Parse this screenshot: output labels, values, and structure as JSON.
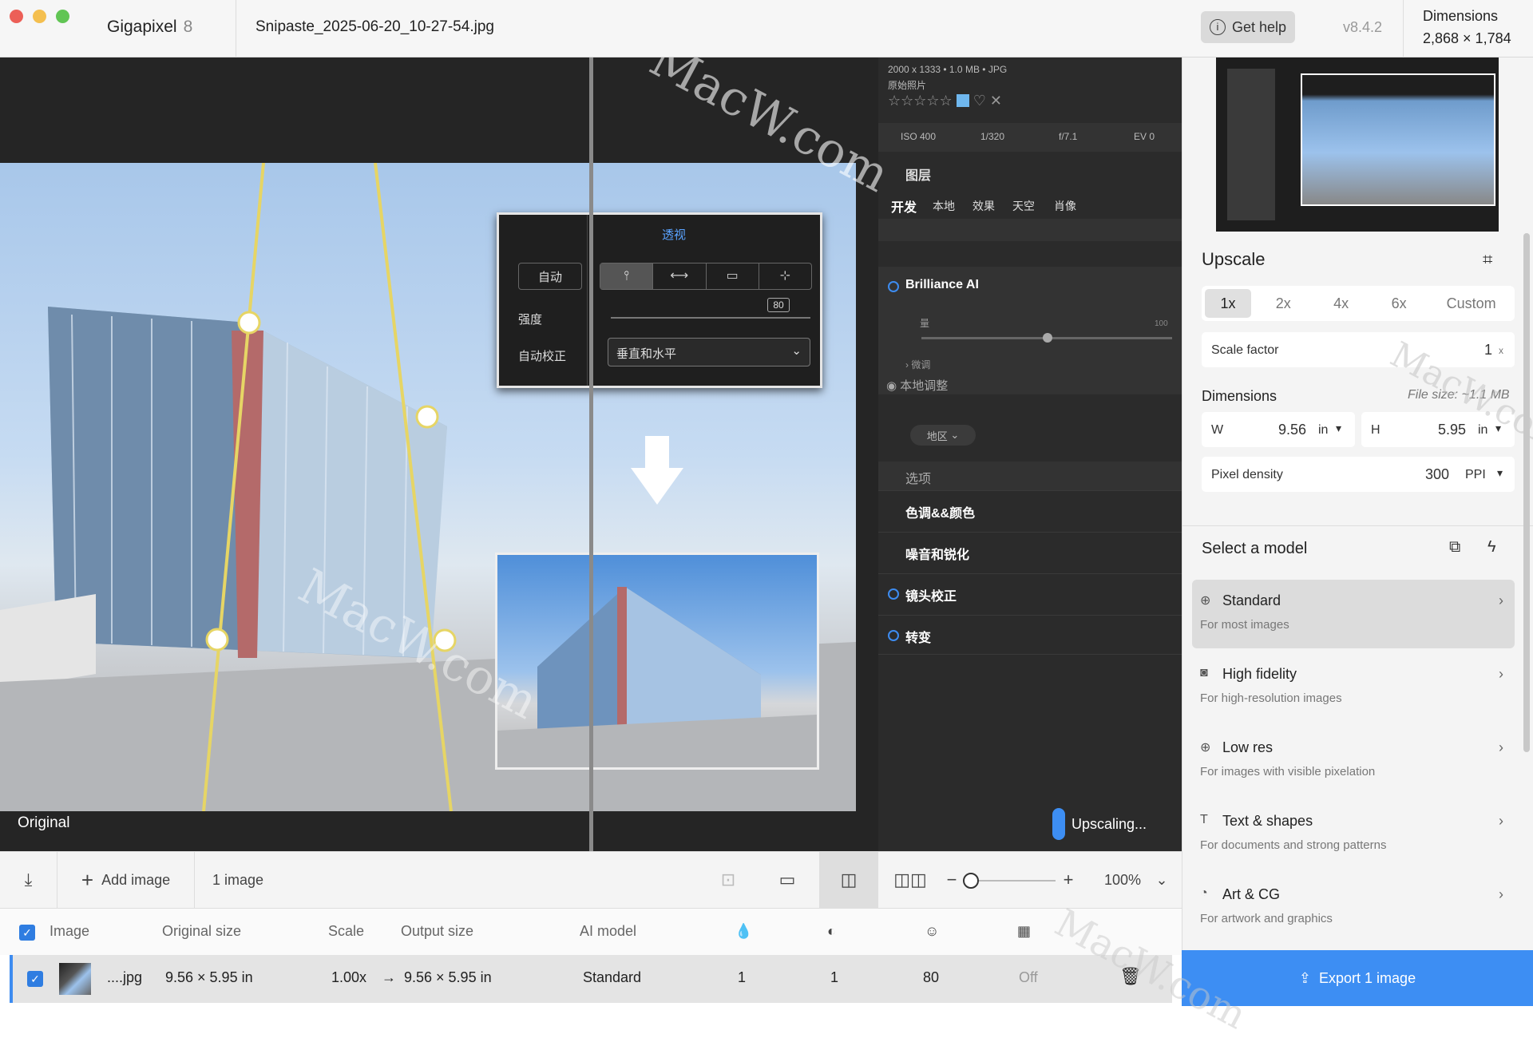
{
  "window": {
    "app_name": "Gigapixel",
    "app_version_major": "8",
    "file_name": "Snipaste_2025-06-20_10-27-54.jpg",
    "help_label": "Get help",
    "version": "v8.4.2",
    "dimensions_label": "Dimensions",
    "dimensions_value": "2,868 × 1,784"
  },
  "viewer": {
    "original_label": "Original",
    "upscaling_status": "Upscaling...",
    "watermark": "MacW.com",
    "embedded_screenshot": {
      "meta_size": "2000 x 1333 • 1.0 MB • JPG",
      "meta_subtitle": "原始照片",
      "exif": [
        "ISO 400",
        "1/320",
        "f/7.1",
        "EV 0"
      ],
      "layers_title": "图层",
      "tabs": [
        "开发",
        "本地",
        "效果",
        "天空",
        "肖像"
      ],
      "brilliance": "Brilliance AI",
      "amount_label": "量",
      "amount_max": "100",
      "fine_tune": "微调",
      "local_adjust": "本地调整",
      "region": "地区",
      "options": "选项",
      "tone_color": "色调&&颜色",
      "noise_sharpen": "噪音和锐化",
      "lens_correction": "镜头校正",
      "transform": "转变",
      "perspective": {
        "title": "透视",
        "auto_button": "自动",
        "strength_label": "强度",
        "strength_value": "80",
        "auto_correct_label": "自动校正",
        "auto_correct_value": "垂直和水平"
      }
    }
  },
  "toolbar": {
    "add_image": "Add image",
    "image_count": "1 image",
    "zoom": "100%"
  },
  "table": {
    "headers": [
      "Image",
      "Original size",
      "Scale",
      "Output size",
      "AI model"
    ],
    "row": {
      "name": "....jpg",
      "original_size": "9.56 × 5.95 in",
      "scale": "1.00x",
      "arrow": "→",
      "output_size": "9.56 × 5.95 in",
      "ai_model": "Standard",
      "col_drop": "1",
      "col_circle": "1",
      "col_face": "80",
      "col_off": "Off"
    }
  },
  "upscale": {
    "title": "Upscale",
    "scale_options": [
      "1x",
      "2x",
      "4x",
      "6x",
      "Custom"
    ],
    "selected_scale": "1x",
    "scale_factor_label": "Scale factor",
    "scale_factor_value": "1",
    "scale_factor_unit": "x",
    "dimensions_label": "Dimensions",
    "file_size": "File size: ~1.1 MB",
    "w_label": "W",
    "w_value": "9.56",
    "h_label": "H",
    "h_value": "5.95",
    "unit": "in",
    "pixel_density_label": "Pixel density",
    "pixel_density_value": "300",
    "pixel_density_unit": "PPI"
  },
  "models": {
    "title": "Select a model",
    "items": [
      {
        "name": "Standard",
        "desc": "For most images"
      },
      {
        "name": "High fidelity",
        "desc": "For high-resolution images"
      },
      {
        "name": "Low res",
        "desc": "For images with visible pixelation"
      },
      {
        "name": "Text & shapes",
        "desc": "For documents and strong patterns"
      },
      {
        "name": "Art & CG",
        "desc": "For artwork and graphics"
      }
    ]
  },
  "export_label": "Export 1 image",
  "colors": {
    "accent": "#3d8ef3",
    "panel": "#f4f4f4",
    "viewer": "#252525"
  }
}
